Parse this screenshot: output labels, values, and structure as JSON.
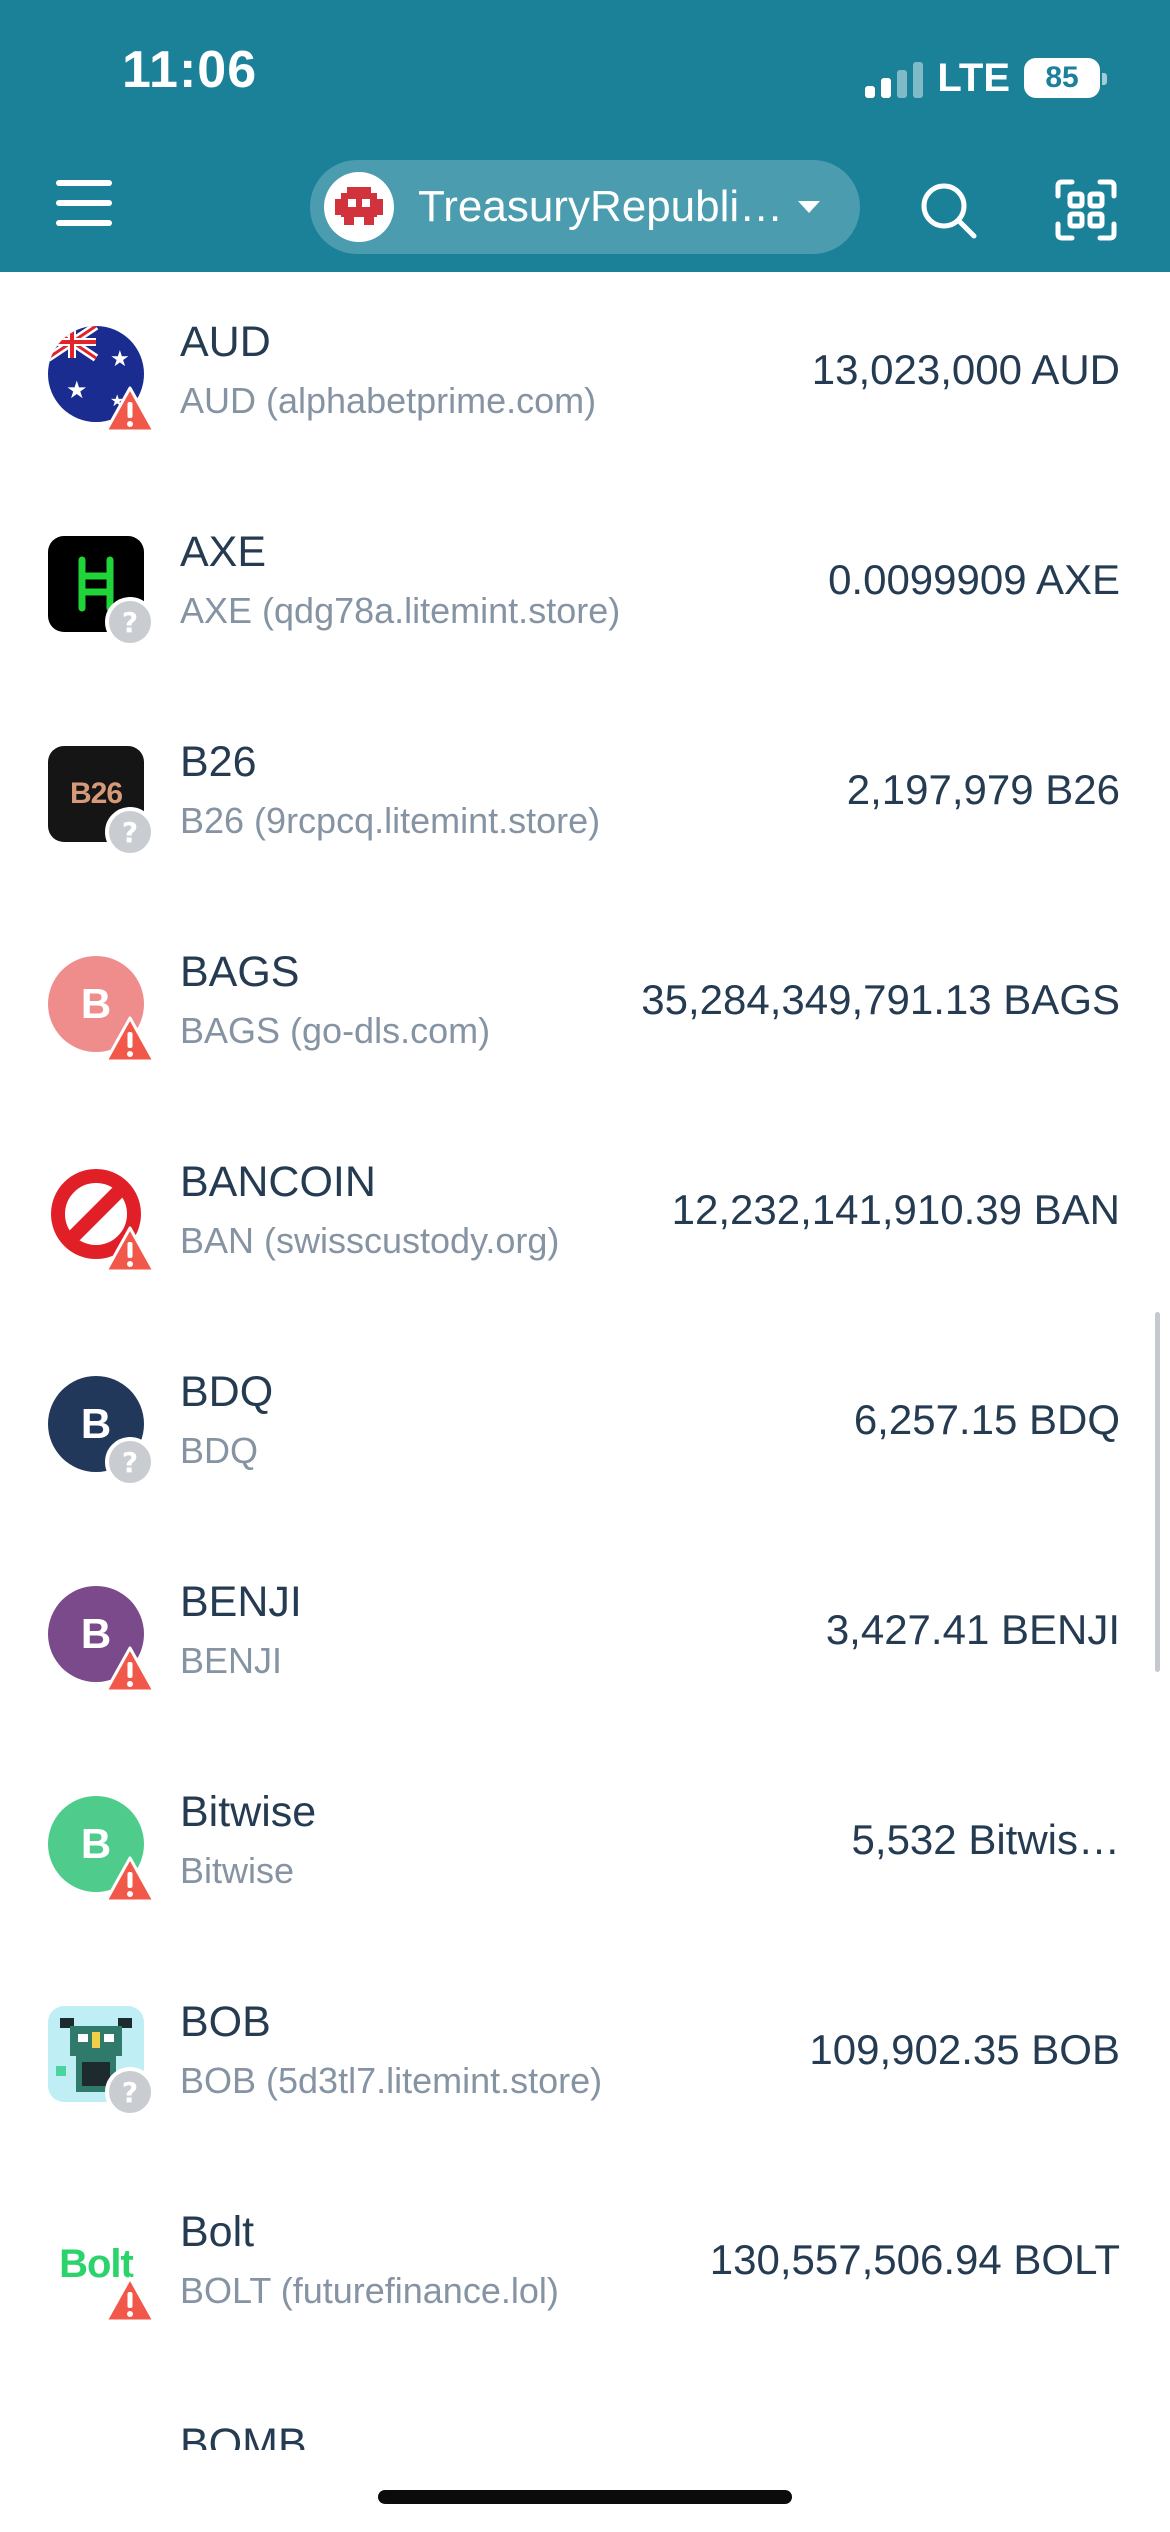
{
  "status_bar": {
    "time": "11:06",
    "network": "LTE",
    "battery": "85"
  },
  "header": {
    "account_name": "TreasuryRepubli…",
    "menu_icon": "hamburger-menu-icon",
    "search_icon": "search-icon",
    "scan_icon": "qr-scan-icon",
    "brand_color": "#1a8199"
  },
  "tokens": [
    {
      "name": "AUD",
      "sub": "AUD (alphabetprime.com)",
      "amount": "13,023,000 AUD",
      "icon": "australia-flag-icon",
      "status": "warning"
    },
    {
      "name": "AXE",
      "sub": "AXE (qdg78a.litemint.store)",
      "amount": "0.0099909 AXE",
      "icon": "hbar-logo-icon",
      "status": "unknown"
    },
    {
      "name": "B26",
      "sub": "B26 (9rcpcq.litemint.store)",
      "amount": "2,197,979 B26",
      "icon": "b26-logo-icon",
      "logo_text": "B26",
      "status": "unknown"
    },
    {
      "name": "BAGS",
      "sub": "BAGS (go-dls.com)",
      "amount": "35,284,349,791.13 BAGS",
      "icon": "letter-avatar",
      "letter": "B",
      "color": "#ef8d8d",
      "status": "warning"
    },
    {
      "name": "BANCOIN",
      "sub": "BAN (swisscustody.org)",
      "amount": "12,232,141,910.39 BAN",
      "icon": "prohibited-sign-icon",
      "status": "warning"
    },
    {
      "name": "BDQ",
      "sub": "BDQ",
      "amount": "6,257.15 BDQ",
      "icon": "letter-avatar",
      "letter": "B",
      "color": "#22385a",
      "status": "unknown"
    },
    {
      "name": "BENJI",
      "sub": "BENJI",
      "amount": "3,427.41 BENJI",
      "icon": "letter-avatar",
      "letter": "B",
      "color": "#7b4a8a",
      "status": "warning"
    },
    {
      "name": "Bitwise",
      "sub": "Bitwise",
      "amount": "5,532 Bitwis…",
      "icon": "letter-avatar",
      "letter": "B",
      "color": "#4fcc8c",
      "status": "warning"
    },
    {
      "name": "BOB",
      "sub": "BOB (5d3tl7.litemint.store)",
      "amount": "109,902.35 BOB",
      "icon": "pixel-art-avatar-icon",
      "status": "unknown"
    },
    {
      "name": "Bolt",
      "sub": "BOLT (futurefinance.lol)",
      "amount": "130,557,506.94 BOLT",
      "icon": "bolt-logo-icon",
      "logo_text": "Bolt",
      "status": "warning"
    }
  ],
  "partial_next": "BOMB"
}
